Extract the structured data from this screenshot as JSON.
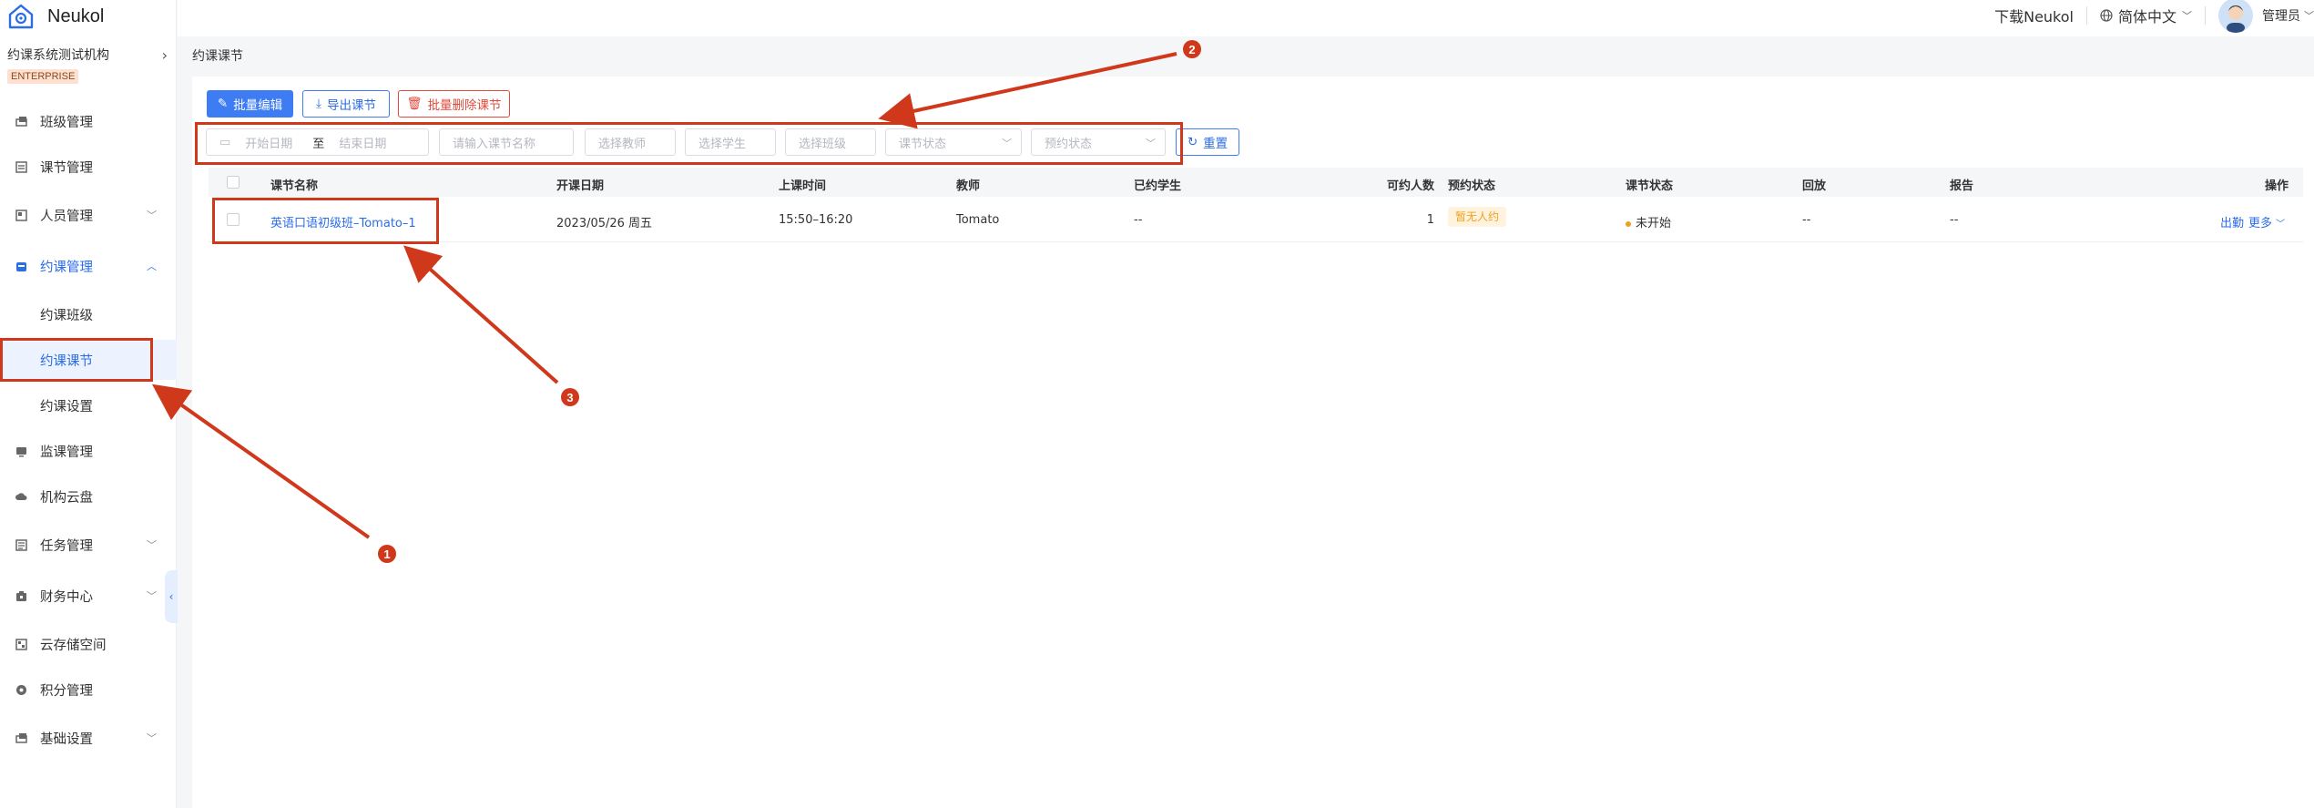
{
  "brand": {
    "name": "Neukol"
  },
  "org": {
    "name": "约课系统测试机构",
    "badge": "ENTERPRISE"
  },
  "sidebar": {
    "items": [
      {
        "label": "班级管理"
      },
      {
        "label": "课节管理"
      },
      {
        "label": "人员管理"
      },
      {
        "label": "约课管理"
      },
      {
        "label": "监课管理"
      },
      {
        "label": "机构云盘"
      },
      {
        "label": "任务管理"
      },
      {
        "label": "财务中心"
      },
      {
        "label": "云存储空间"
      },
      {
        "label": "积分管理"
      },
      {
        "label": "基础设置"
      }
    ],
    "sub_items": [
      {
        "label": "约课班级"
      },
      {
        "label": "约课课节"
      },
      {
        "label": "约课设置"
      }
    ]
  },
  "header": {
    "download": "下载Neukol",
    "language": "简体中文",
    "user": "管理员"
  },
  "page": {
    "breadcrumb": "约课课节"
  },
  "toolbar": {
    "batch_edit": "批量编辑",
    "export": "导出课节",
    "batch_delete": "批量删除课节"
  },
  "filters": {
    "start_date": "开始日期",
    "to": "至",
    "end_date": "结束日期",
    "lesson_name": "请输入课节名称",
    "teacher": "选择教师",
    "student": "选择学生",
    "class": "选择班级",
    "lesson_status": "课节状态",
    "booking_status": "预约状态",
    "reset": "重置"
  },
  "table": {
    "headers": [
      "课节名称",
      "开课日期",
      "上课时间",
      "教师",
      "已约学生",
      "可约人数",
      "预约状态",
      "课节状态",
      "回放",
      "报告",
      "操作"
    ],
    "rows": [
      {
        "name": "英语口语初级班–Tomato–1",
        "date": "2023/05/26 周五",
        "time": "15:50–16:20",
        "teacher": "Tomato",
        "booked": "--",
        "capacity": "1",
        "booking_status": "暂无人约",
        "lesson_status": "未开始",
        "replay": "--",
        "report": "--",
        "action_attend": "出勤",
        "action_more": "更多"
      }
    ]
  },
  "annotations": {
    "markers": [
      "1",
      "2",
      "3"
    ],
    "color": "#d0381c"
  },
  "colors": {
    "primary": "#3d7cf2",
    "danger": "#e24a3c",
    "warning": "#f0a020"
  }
}
